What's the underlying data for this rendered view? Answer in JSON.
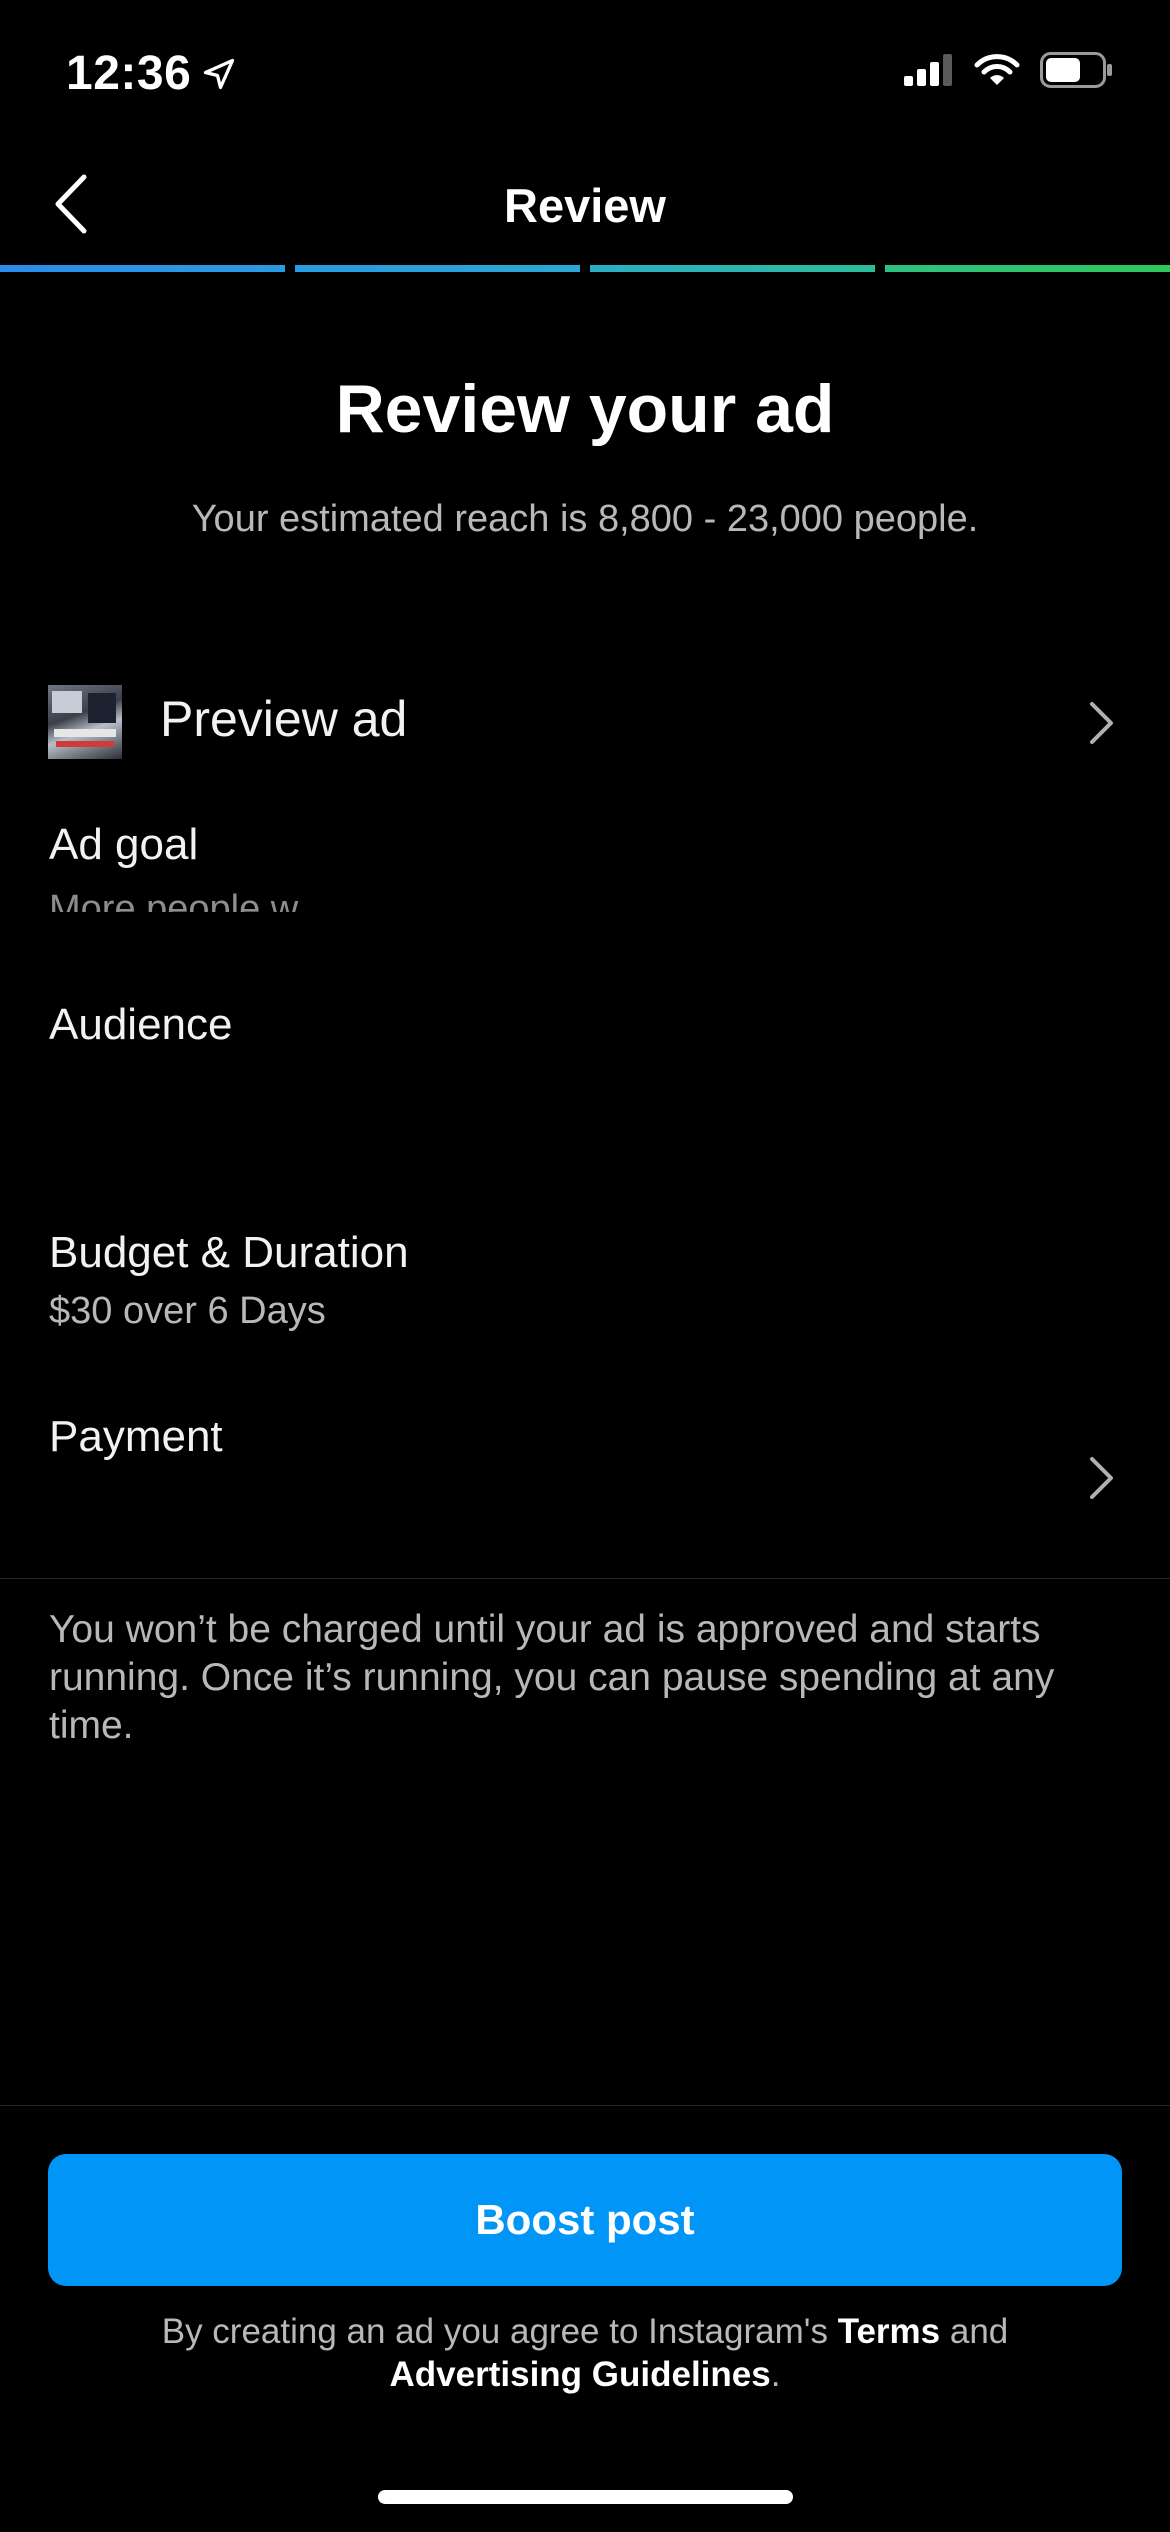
{
  "status_bar": {
    "time": "12:36",
    "location_icon": "location-arrow-icon",
    "signal_icon": "cellular-signal-icon",
    "wifi_icon": "wifi-icon",
    "battery_icon": "battery-icon"
  },
  "nav": {
    "title": "Review",
    "back_icon": "chevron-left-icon"
  },
  "progress": {
    "steps_total": 4,
    "steps_completed": 4,
    "colors": [
      "#2a8dea",
      "#2a9be0",
      "#2aaec3",
      "#2fc65c"
    ]
  },
  "header": {
    "title": "Review your ad",
    "reach": "Your estimated reach is 8,800 - 23,000 people."
  },
  "preview": {
    "label": "Preview ad",
    "chevron_icon": "chevron-right-icon"
  },
  "ad_goal": {
    "label": "Ad goal",
    "value_partial": "More people w"
  },
  "audience": {
    "label": "Audience"
  },
  "budget": {
    "label": "Budget & Duration",
    "value": "$30 over 6 Days"
  },
  "payment": {
    "label": "Payment",
    "chevron_icon": "chevron-right-icon"
  },
  "charge_note": "You won’t be charged until your ad is approved and starts running. Once it’s running, you can pause spending at any time.",
  "boost_button": "Boost post",
  "legal": {
    "prefix": "By creating an ad you agree to Instagram's ",
    "terms": "Terms",
    "middle": " and ",
    "guidelines": "Advertising Guidelines",
    "suffix": "."
  },
  "colors": {
    "accent": "#0095f6",
    "background": "#000000",
    "secondary_text": "#b8b8b8"
  }
}
